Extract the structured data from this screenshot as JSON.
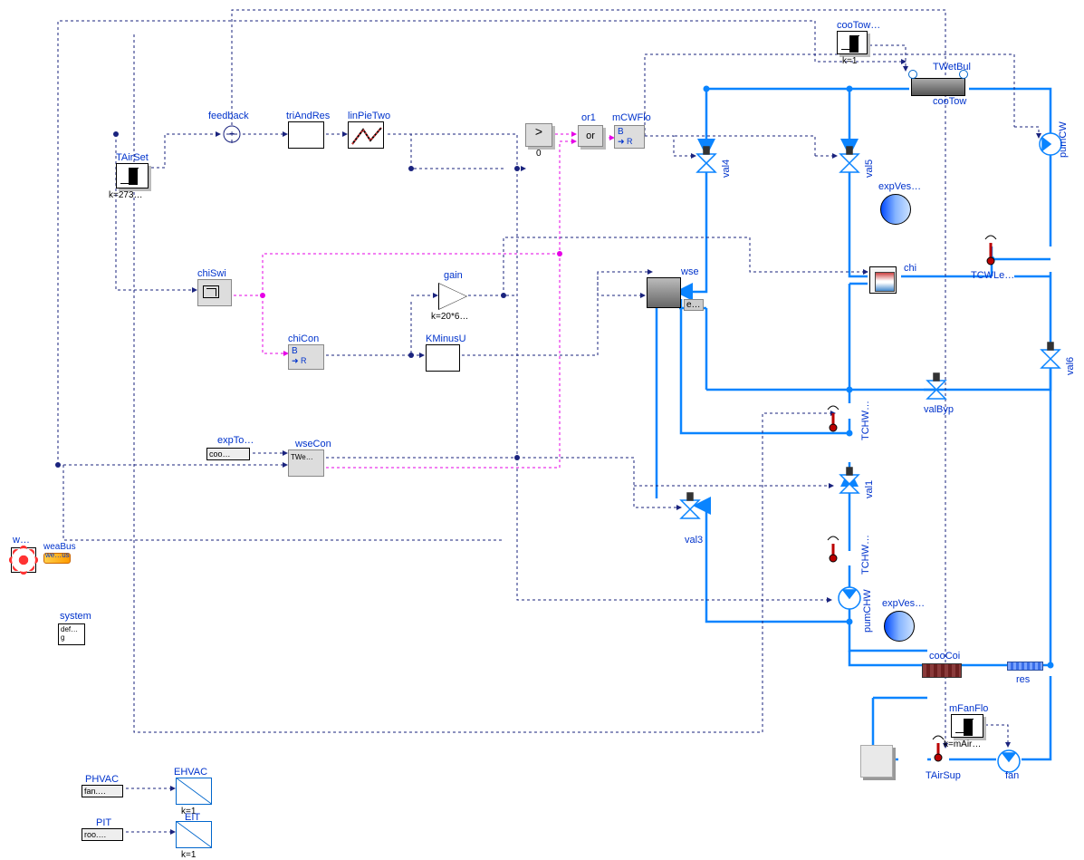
{
  "blocks": {
    "weather": {
      "label": "w…",
      "bus_label": "weaBus",
      "bus_label2": "we…us"
    },
    "system": {
      "label": "system",
      "sub": "def… g"
    },
    "TAirSet": {
      "label": "TAirSet",
      "k": "k=273…"
    },
    "feedback": {
      "label": "feedback"
    },
    "triAndRes": {
      "label": "triAndRes"
    },
    "linPieTwo": {
      "label": "linPieTwo"
    },
    "chiSwi": {
      "label": "chiSwi"
    },
    "chiCon": {
      "label": "chiCon",
      "op": "B",
      "sub": "➜ R"
    },
    "gain": {
      "label": "gain",
      "k": "k=20*6…"
    },
    "KMinusU": {
      "label": "KMinusU"
    },
    "expTo": {
      "label": "expTo…",
      "sub": "coo…"
    },
    "wseCon": {
      "label": "wseCon",
      "sub": "TWe…"
    },
    "greater0": {
      "top": ">",
      "k": "0"
    },
    "or1": {
      "label": "or1",
      "body": "or"
    },
    "mCWFlo": {
      "label": "mCWFlo",
      "op": "B",
      "sub": "➜ R"
    },
    "val4": {
      "label": "val4"
    },
    "val5": {
      "label": "val5"
    },
    "val6": {
      "label": "val6"
    },
    "val3": {
      "label": "val3"
    },
    "val1": {
      "label": "val1"
    },
    "valByp": {
      "label": "valByp"
    },
    "expVesChi": {
      "label": "expVes…"
    },
    "expVesCHW": {
      "label": "expVes…"
    },
    "cooTowConst": {
      "label": "cooTow…",
      "k": "k=1"
    },
    "TWetBul": {
      "label": "TWetBul"
    },
    "cooTow": {
      "label": "cooTow"
    },
    "pumCW": {
      "label": "pumCW"
    },
    "TCWLe": {
      "label": "TCWLe…"
    },
    "wse": {
      "label": "wse",
      "e": "e…"
    },
    "chi": {
      "label": "chi"
    },
    "TCHW1": {
      "label": "TCHW…"
    },
    "TCHW2": {
      "label": "TCHW…"
    },
    "pumCHW": {
      "label": "pumCHW"
    },
    "cooCoi": {
      "label": "cooCoi"
    },
    "res": {
      "label": "res"
    },
    "mFanFlo": {
      "label": "mFanFlo",
      "k": "k=mAir…"
    },
    "TAirSup": {
      "label": "TAirSup"
    },
    "fan": {
      "label": "fan"
    },
    "PHVAC": {
      "label": "PHVAC",
      "sub": "fan.…"
    },
    "EHVAC": {
      "label": "EHVAC",
      "k": "k=1"
    },
    "PIT": {
      "label": "PIT",
      "sub": "roo.…"
    },
    "EIT": {
      "label": "EIT",
      "k": "k=1"
    }
  }
}
